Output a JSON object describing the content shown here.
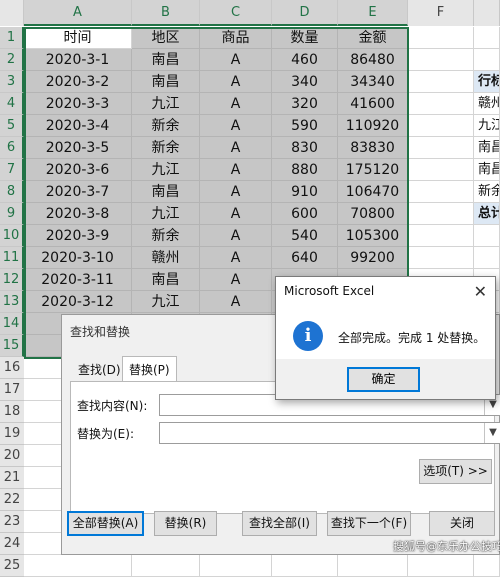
{
  "columns": [
    "A",
    "B",
    "C",
    "D",
    "E",
    "F"
  ],
  "rows": [
    "1",
    "2",
    "3",
    "4",
    "5",
    "6",
    "7",
    "8",
    "9",
    "10",
    "11",
    "12",
    "13",
    "14",
    "15",
    "16",
    "17",
    "18",
    "19",
    "20",
    "21",
    "22",
    "23",
    "24",
    "25"
  ],
  "header": {
    "time": "时间",
    "region": "地区",
    "product": "商品",
    "qty": "数量",
    "amount": "金额"
  },
  "data_rows": [
    {
      "time": "2020-3-1",
      "region": "南昌",
      "product": "A",
      "qty": "460",
      "amount": "86480"
    },
    {
      "time": "2020-3-2",
      "region": "南昌",
      "product": "A",
      "qty": "340",
      "amount": "34340"
    },
    {
      "time": "2020-3-3",
      "region": "九江",
      "product": "A",
      "qty": "320",
      "amount": "41600"
    },
    {
      "time": "2020-3-4",
      "region": "新余",
      "product": "A",
      "qty": "590",
      "amount": "110920"
    },
    {
      "time": "2020-3-5",
      "region": "新余",
      "product": "A",
      "qty": "830",
      "amount": "83830"
    },
    {
      "time": "2020-3-6",
      "region": "九江",
      "product": "A",
      "qty": "880",
      "amount": "175120"
    },
    {
      "time": "2020-3-7",
      "region": "南昌",
      "product": "A",
      "qty": "910",
      "amount": "106470"
    },
    {
      "time": "2020-3-8",
      "region": "九江",
      "product": "A",
      "qty": "600",
      "amount": "70800"
    },
    {
      "time": "2020-3-9",
      "region": "新余",
      "product": "A",
      "qty": "540",
      "amount": "105300"
    },
    {
      "time": "2020-3-10",
      "region": "赣州",
      "product": "A",
      "qty": "640",
      "amount": "99200"
    },
    {
      "time": "2020-3-11",
      "region": "南昌",
      "product": "A",
      "qty": "",
      "amount": ""
    },
    {
      "time": "2020-3-12",
      "region": "九江",
      "product": "A",
      "qty": "",
      "amount": ""
    },
    {
      "time": "20",
      "region": "",
      "product": "",
      "qty": "",
      "amount": ""
    },
    {
      "time": "20",
      "region": "",
      "product": "",
      "qty": "",
      "amount": ""
    }
  ],
  "side_cells": [
    "行标",
    "赣州",
    "九江",
    "南昌",
    "南昌",
    "新余",
    "总计"
  ],
  "find_dialog": {
    "title": "查找和替换",
    "tab_find": "查找(D)",
    "tab_replace": "替换(P)",
    "find_label": "查找内容(N):",
    "replace_label": "替换为(E):",
    "options_button": "选项(T) >>",
    "replace_all": "全部替换(A)",
    "replace": "替换(R)",
    "find_all": "查找全部(I)",
    "find_next": "查找下一个(F)",
    "close": "关闭",
    "find_value": "",
    "replace_value": ""
  },
  "msgbox": {
    "title": "Microsoft Excel",
    "message": "全部完成。完成 1 处替换。",
    "ok": "确定",
    "icon": "info-icon",
    "close_glyph": "✕"
  },
  "watermark": "搜狐号@东乐办公技巧",
  "colors": {
    "selection": "#217346",
    "shaded": "#c6c6c6",
    "info": "#1e73d2",
    "default_button": "#0078d7"
  }
}
